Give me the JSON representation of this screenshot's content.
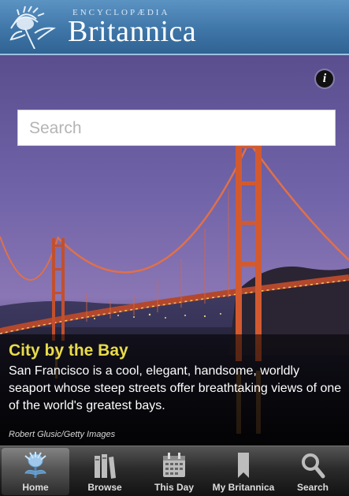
{
  "header": {
    "brand_top": "ENCYCLOPÆDIA",
    "brand_main": "Britannica"
  },
  "info_button": {
    "label": "i"
  },
  "search": {
    "placeholder": "Search"
  },
  "feature": {
    "title": "City by the Bay",
    "body": "San Francisco is a cool, elegant, handsome, worldly seaport whose steep streets offer breathtaking views of one of the world's greatest bays.",
    "credit": "Robert Glusic/Getty Images"
  },
  "tabs": [
    {
      "label": "Home",
      "icon": "thistle-icon",
      "active": true
    },
    {
      "label": "Browse",
      "icon": "books-icon",
      "active": false
    },
    {
      "label": "This Day",
      "icon": "calendar-icon",
      "active": false
    },
    {
      "label": "My Britannica",
      "icon": "bookmark-icon",
      "active": false
    },
    {
      "label": "Search",
      "icon": "magnifier-icon",
      "active": false
    }
  ]
}
